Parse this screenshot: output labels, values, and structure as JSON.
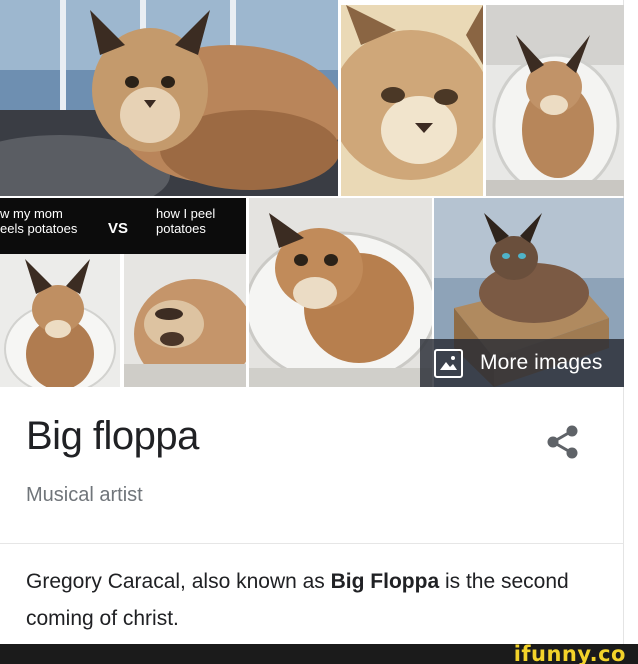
{
  "knowledge_panel": {
    "images": {
      "meme": {
        "left_caption": "w my mom\neels potatoes",
        "vs": "VS",
        "right_caption": "how I peel\npotatoes"
      },
      "more_images_label": "More images"
    },
    "title": "Big floppa",
    "subtitle": "Musical artist",
    "description": {
      "part1": "Gregory Caracal, also known as ",
      "bold": "Big Floppa",
      "part2": " is the second coming of christ."
    }
  },
  "watermark": "ifunny.co",
  "colors": {
    "title": "#202124",
    "subtitle": "#70757a",
    "watermark": "#f3d32a",
    "overlay": "#282c34"
  },
  "icons": [
    "image-icon",
    "share-icon"
  ]
}
